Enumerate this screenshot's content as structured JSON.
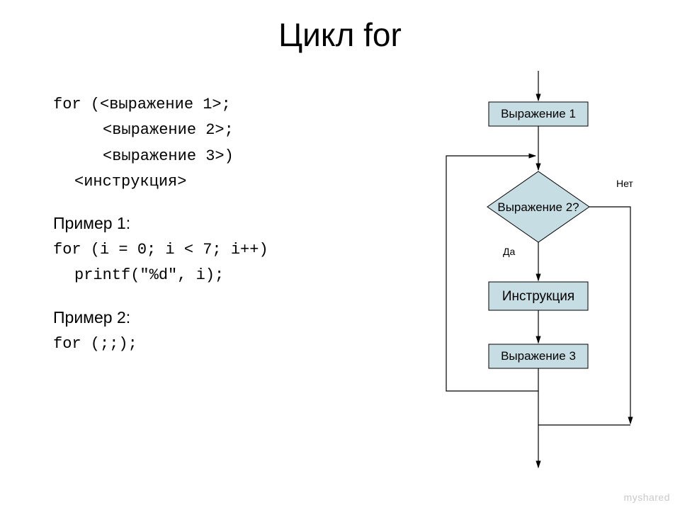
{
  "title": "Цикл for",
  "syntax": {
    "line1": "for (<выражение 1>;",
    "line2": "<выражение 2>;",
    "line3": "<выражение 3>)",
    "line4": "<инструкция>"
  },
  "example1": {
    "heading": "Пример 1:",
    "code1": "for (i = 0; i < 7; i++)",
    "code2": "printf(\"%d\", i);"
  },
  "example2": {
    "heading": "Пример 2:",
    "code1": "for (;;);"
  },
  "flowchart": {
    "box1": "Выражение 1",
    "decision": "Выражение 2?",
    "box2": "Инструкция",
    "box3": "Выражение 3",
    "yes": "Да",
    "no": "Нет"
  },
  "watermark": "myshared"
}
